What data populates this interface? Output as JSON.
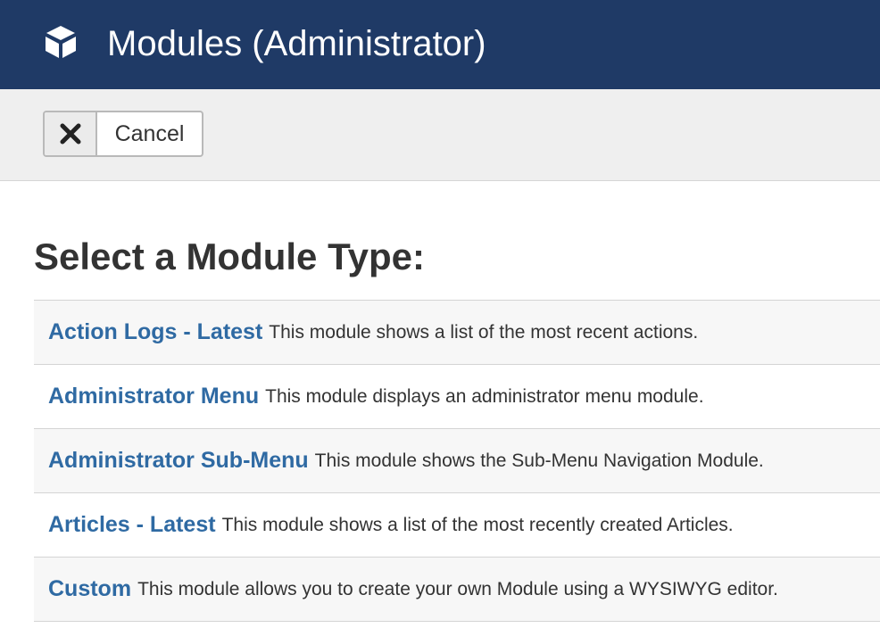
{
  "header": {
    "title": "Modules (Administrator)",
    "icon": "cube-icon",
    "background": "#1f3a66"
  },
  "toolbar": {
    "cancel_label": "Cancel",
    "cancel_icon": "close-icon"
  },
  "main": {
    "title": "Select a Module Type:"
  },
  "modules": [
    {
      "name": "Action Logs - Latest",
      "description": "This module shows a list of the most recent actions."
    },
    {
      "name": "Administrator Menu",
      "description": "This module displays an administrator menu module."
    },
    {
      "name": "Administrator Sub-Menu",
      "description": "This module shows the Sub-Menu Navigation Module."
    },
    {
      "name": "Articles - Latest",
      "description": "This module shows a list of the most recently created Articles."
    },
    {
      "name": "Custom",
      "description": "This module allows you to create your own Module using a WYSIWYG editor."
    }
  ],
  "colors": {
    "link": "#2f6aa3",
    "text": "#333333"
  }
}
